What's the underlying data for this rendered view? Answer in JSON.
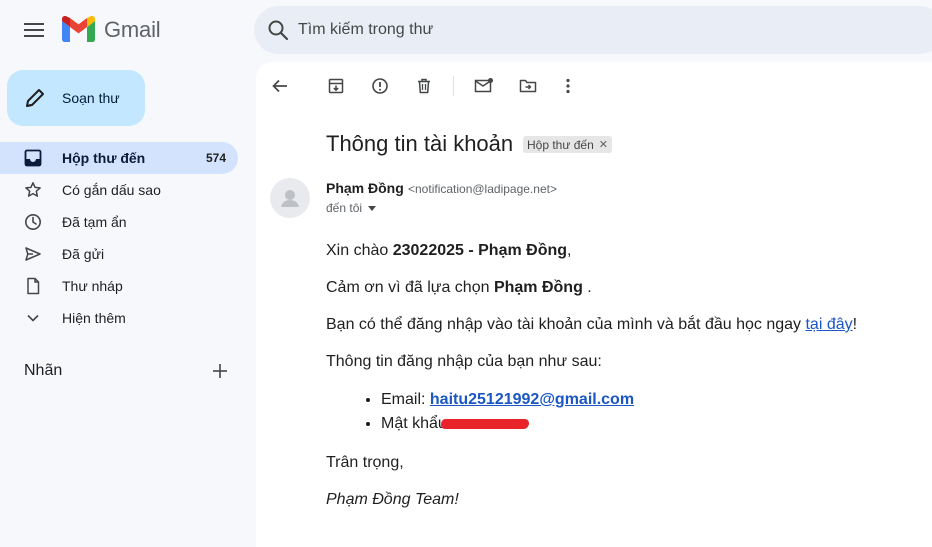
{
  "header": {
    "app_name": "Gmail",
    "search_placeholder": "Tìm kiếm trong thư"
  },
  "compose": {
    "label": "Soạn thư"
  },
  "sidebar": {
    "items": [
      {
        "label": "Hộp thư đến",
        "count": "574",
        "icon": "inbox-icon",
        "active": true
      },
      {
        "label": "Có gắn dấu sao",
        "icon": "star-icon"
      },
      {
        "label": "Đã tạm ẩn",
        "icon": "clock-icon"
      },
      {
        "label": "Đã gửi",
        "icon": "send-icon"
      },
      {
        "label": "Thư nháp",
        "icon": "draft-icon"
      },
      {
        "label": "Hiện thêm",
        "icon": "chevron-down-icon"
      }
    ],
    "labels_title": "Nhãn"
  },
  "email": {
    "subject": "Thông tin tài khoản",
    "label_chip": "Hộp thư đến",
    "sender_name": "Phạm Đồng",
    "sender_email": "<notification@ladipage.net>",
    "recipient": "đến tôi",
    "body": {
      "greeting_prefix": "Xin chào ",
      "greeting_name": "23022025 - Phạm Đồng",
      "greeting_suffix": ",",
      "thanks_prefix": "Cảm ơn vì đã lựa chọn ",
      "thanks_name": "Phạm Đồng",
      "thanks_suffix": " .",
      "login_prefix": "Bạn có thể đăng nhập vào tài khoản của mình và bắt đầu học ngay ",
      "login_link": "tại đây",
      "login_suffix": "!",
      "info_line": "Thông tin đăng nhập của bạn như sau:",
      "email_label": "Email: ",
      "email_value": "haitu25121992@gmail.com",
      "password_label": "Mật khẩu",
      "closing": "Trân trọng,",
      "signature": "Phạm Đồng Team!"
    }
  },
  "colors": {
    "accent": "#c2e7ff",
    "active_nav": "#d3e3fd",
    "link": "#1a56c4",
    "redaction": "#e8232a"
  }
}
